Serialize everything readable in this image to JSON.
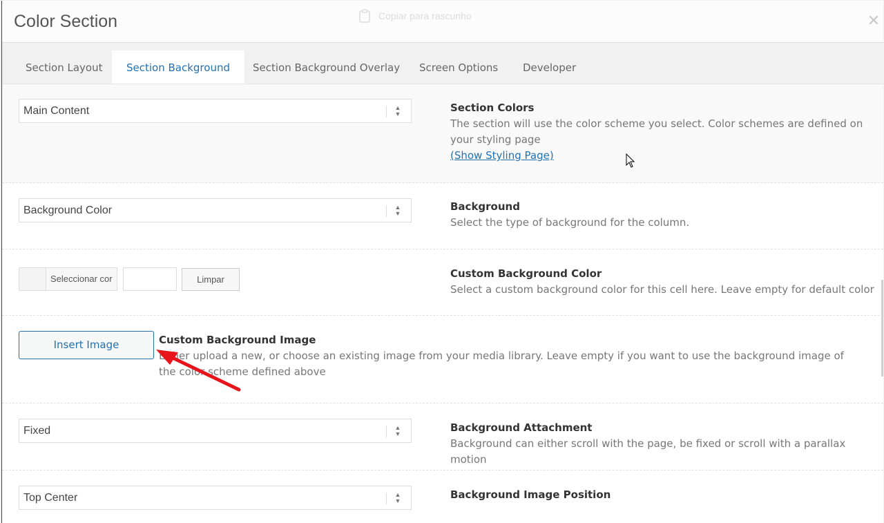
{
  "modal": {
    "title": "Color Section",
    "ghost_text": "Copiar para rascunho",
    "close_icon": "close-icon"
  },
  "tabs": [
    {
      "label": "Section Layout",
      "active": false
    },
    {
      "label": "Section Background",
      "active": true
    },
    {
      "label": "Section Background Overlay",
      "active": false
    },
    {
      "label": "Screen Options",
      "active": false
    },
    {
      "label": "Developer",
      "active": false
    }
  ],
  "rows": {
    "section_colors": {
      "select_value": "Main Content",
      "label": "Section Colors",
      "desc": "The section will use the color scheme you select. Color schemes are defined on your styling page",
      "link": "(Show Styling Page)"
    },
    "background": {
      "select_value": "Background Color",
      "label": "Background",
      "desc": "Select the type of background for the column."
    },
    "custom_bg_color": {
      "picker_label": "Seleccionar cor",
      "hex_value": "",
      "clear_label": "Limpar",
      "label": "Custom Background Color",
      "desc": "Select a custom background color for this cell here. Leave empty for default color"
    },
    "custom_bg_image": {
      "button_label": "Insert Image",
      "label": "Custom Background Image",
      "desc": "Either upload a new, or choose an existing image from your media library. Leave empty if you want to use the background image of the color scheme defined above"
    },
    "bg_attachment": {
      "select_value": "Fixed",
      "label": "Background Attachment",
      "desc": "Background can either scroll with the page, be fixed or scroll with a parallax motion"
    },
    "bg_image_position": {
      "select_value": "Top Center",
      "label": "Background Image Position"
    }
  },
  "colors": {
    "accent": "#2271b1",
    "annotation_arrow": "#e8141b"
  }
}
